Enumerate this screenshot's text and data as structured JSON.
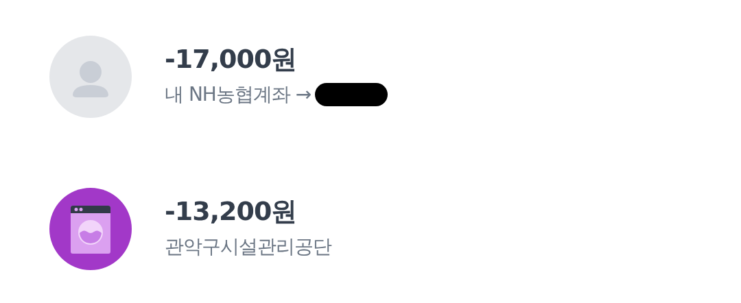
{
  "transactions": [
    {
      "icon": {
        "kind": "person",
        "color": "#e5e7ea"
      },
      "amount": "-17,000원",
      "description": "내 NH농협계좌 →",
      "redacted": true
    },
    {
      "icon": {
        "kind": "washer",
        "color": "#a238c8"
      },
      "amount": "-13,200원",
      "description": "관악구시설관리공단",
      "redacted": false
    }
  ]
}
